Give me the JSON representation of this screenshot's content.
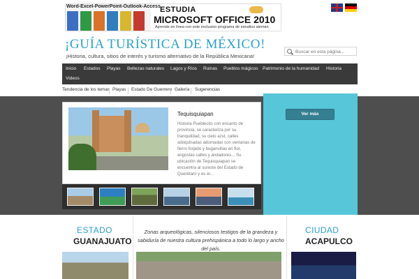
{
  "banner": {
    "top_line": "Word-Excel-PowerPoint-Outlook-Access",
    "headline": "ESTUDIA",
    "product": "MICROSOFT OFFICE 2010",
    "subline": "Aprende en línea con este exclusivo programa de estudios alemán",
    "box_colors": [
      "#3c6fc4",
      "#2f9a45",
      "#d9722b",
      "#2f7ec0",
      "#d8b62e",
      "#c6392f"
    ]
  },
  "languages": [
    "English",
    "Deutsch"
  ],
  "header": {
    "title": "¡GUÍA TURÍSTICA DE MÉXICO!",
    "tagline": "¡Historia, cultura, sitios de interés y turismo alternativo de la República Mexicana!"
  },
  "search": {
    "placeholder": "Buscar en esta página..."
  },
  "main_nav": [
    "Inicio",
    "Estados",
    "Playas",
    "Bellezas naturales",
    "Lagos y Ríos",
    "Ruinas",
    "Pueblos mágicos",
    "Patrimonio de la humanidad",
    "Historia",
    "Videos"
  ],
  "sub_nav": [
    "Tendencia de los temas",
    "Playas",
    "Estado De Guerrero",
    "Galería",
    "Sugerencias"
  ],
  "featured": {
    "title": "Tequisquiapan",
    "description": "Historia Pueblecito con encanto de provincia, se caracteriza por su tranquilidad, su cielo azul, calles adoquinadas adornadas con ventanas de fierro forjado y buganvilias en flor, angostas calles y andadores... Su ubicación de Tequisquiapan se encuentra al sureste del Estado de Querétaro y es el...",
    "button": "Ver más"
  },
  "thumbnails": [
    "thumb-1",
    "thumb-2",
    "thumb-3",
    "thumb-4",
    "thumb-5",
    "thumb-6"
  ],
  "cards": {
    "left": {
      "category": "ESTADO",
      "name": "GUANAJUATO"
    },
    "middle": {
      "text": "Zonas arqueológicas, silenciosos testigos de la grandeza y sabiduría de nuestra cultura prehispánica a todo lo largo y ancho del país."
    },
    "right": {
      "category": "CIUDAD",
      "name": "ACAPULCO"
    }
  },
  "colors": {
    "accent": "#2aa2c8",
    "nav_bg": "#3a3a3a",
    "band_bg": "#4e4e4e",
    "panel_bg": "#56c6d8",
    "button_bg": "#357f92"
  }
}
